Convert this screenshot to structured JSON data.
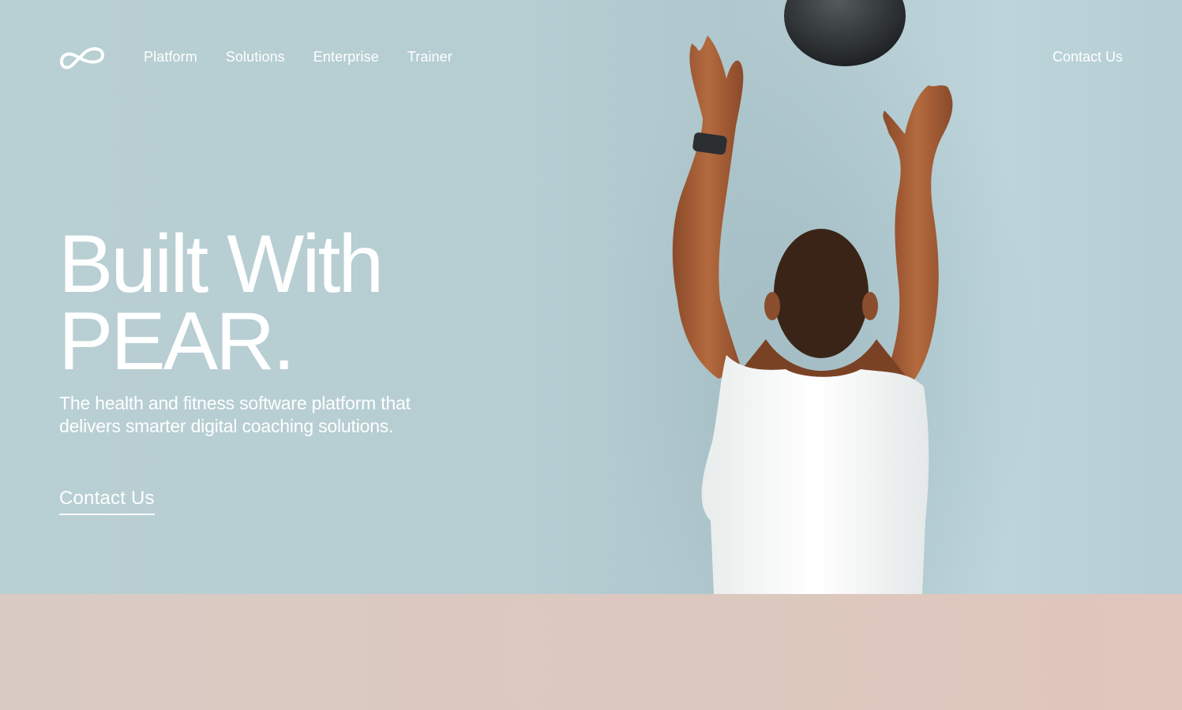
{
  "nav": {
    "links": [
      {
        "label": "Platform"
      },
      {
        "label": "Solutions"
      },
      {
        "label": "Enterprise"
      },
      {
        "label": "Trainer"
      }
    ],
    "contact_label": "Contact Us"
  },
  "hero": {
    "headline_line1": "Built With",
    "headline_line2": "PEAR.",
    "subtitle": "The health and fitness software platform that delivers smarter digital coaching solutions.",
    "cta_label": "Contact Us"
  },
  "colors": {
    "hero_bg": "#b8cfd3",
    "band_bg": "#dcc8bf",
    "text": "#ffffff"
  },
  "icons": {
    "logo": "pear-logo-icon"
  }
}
